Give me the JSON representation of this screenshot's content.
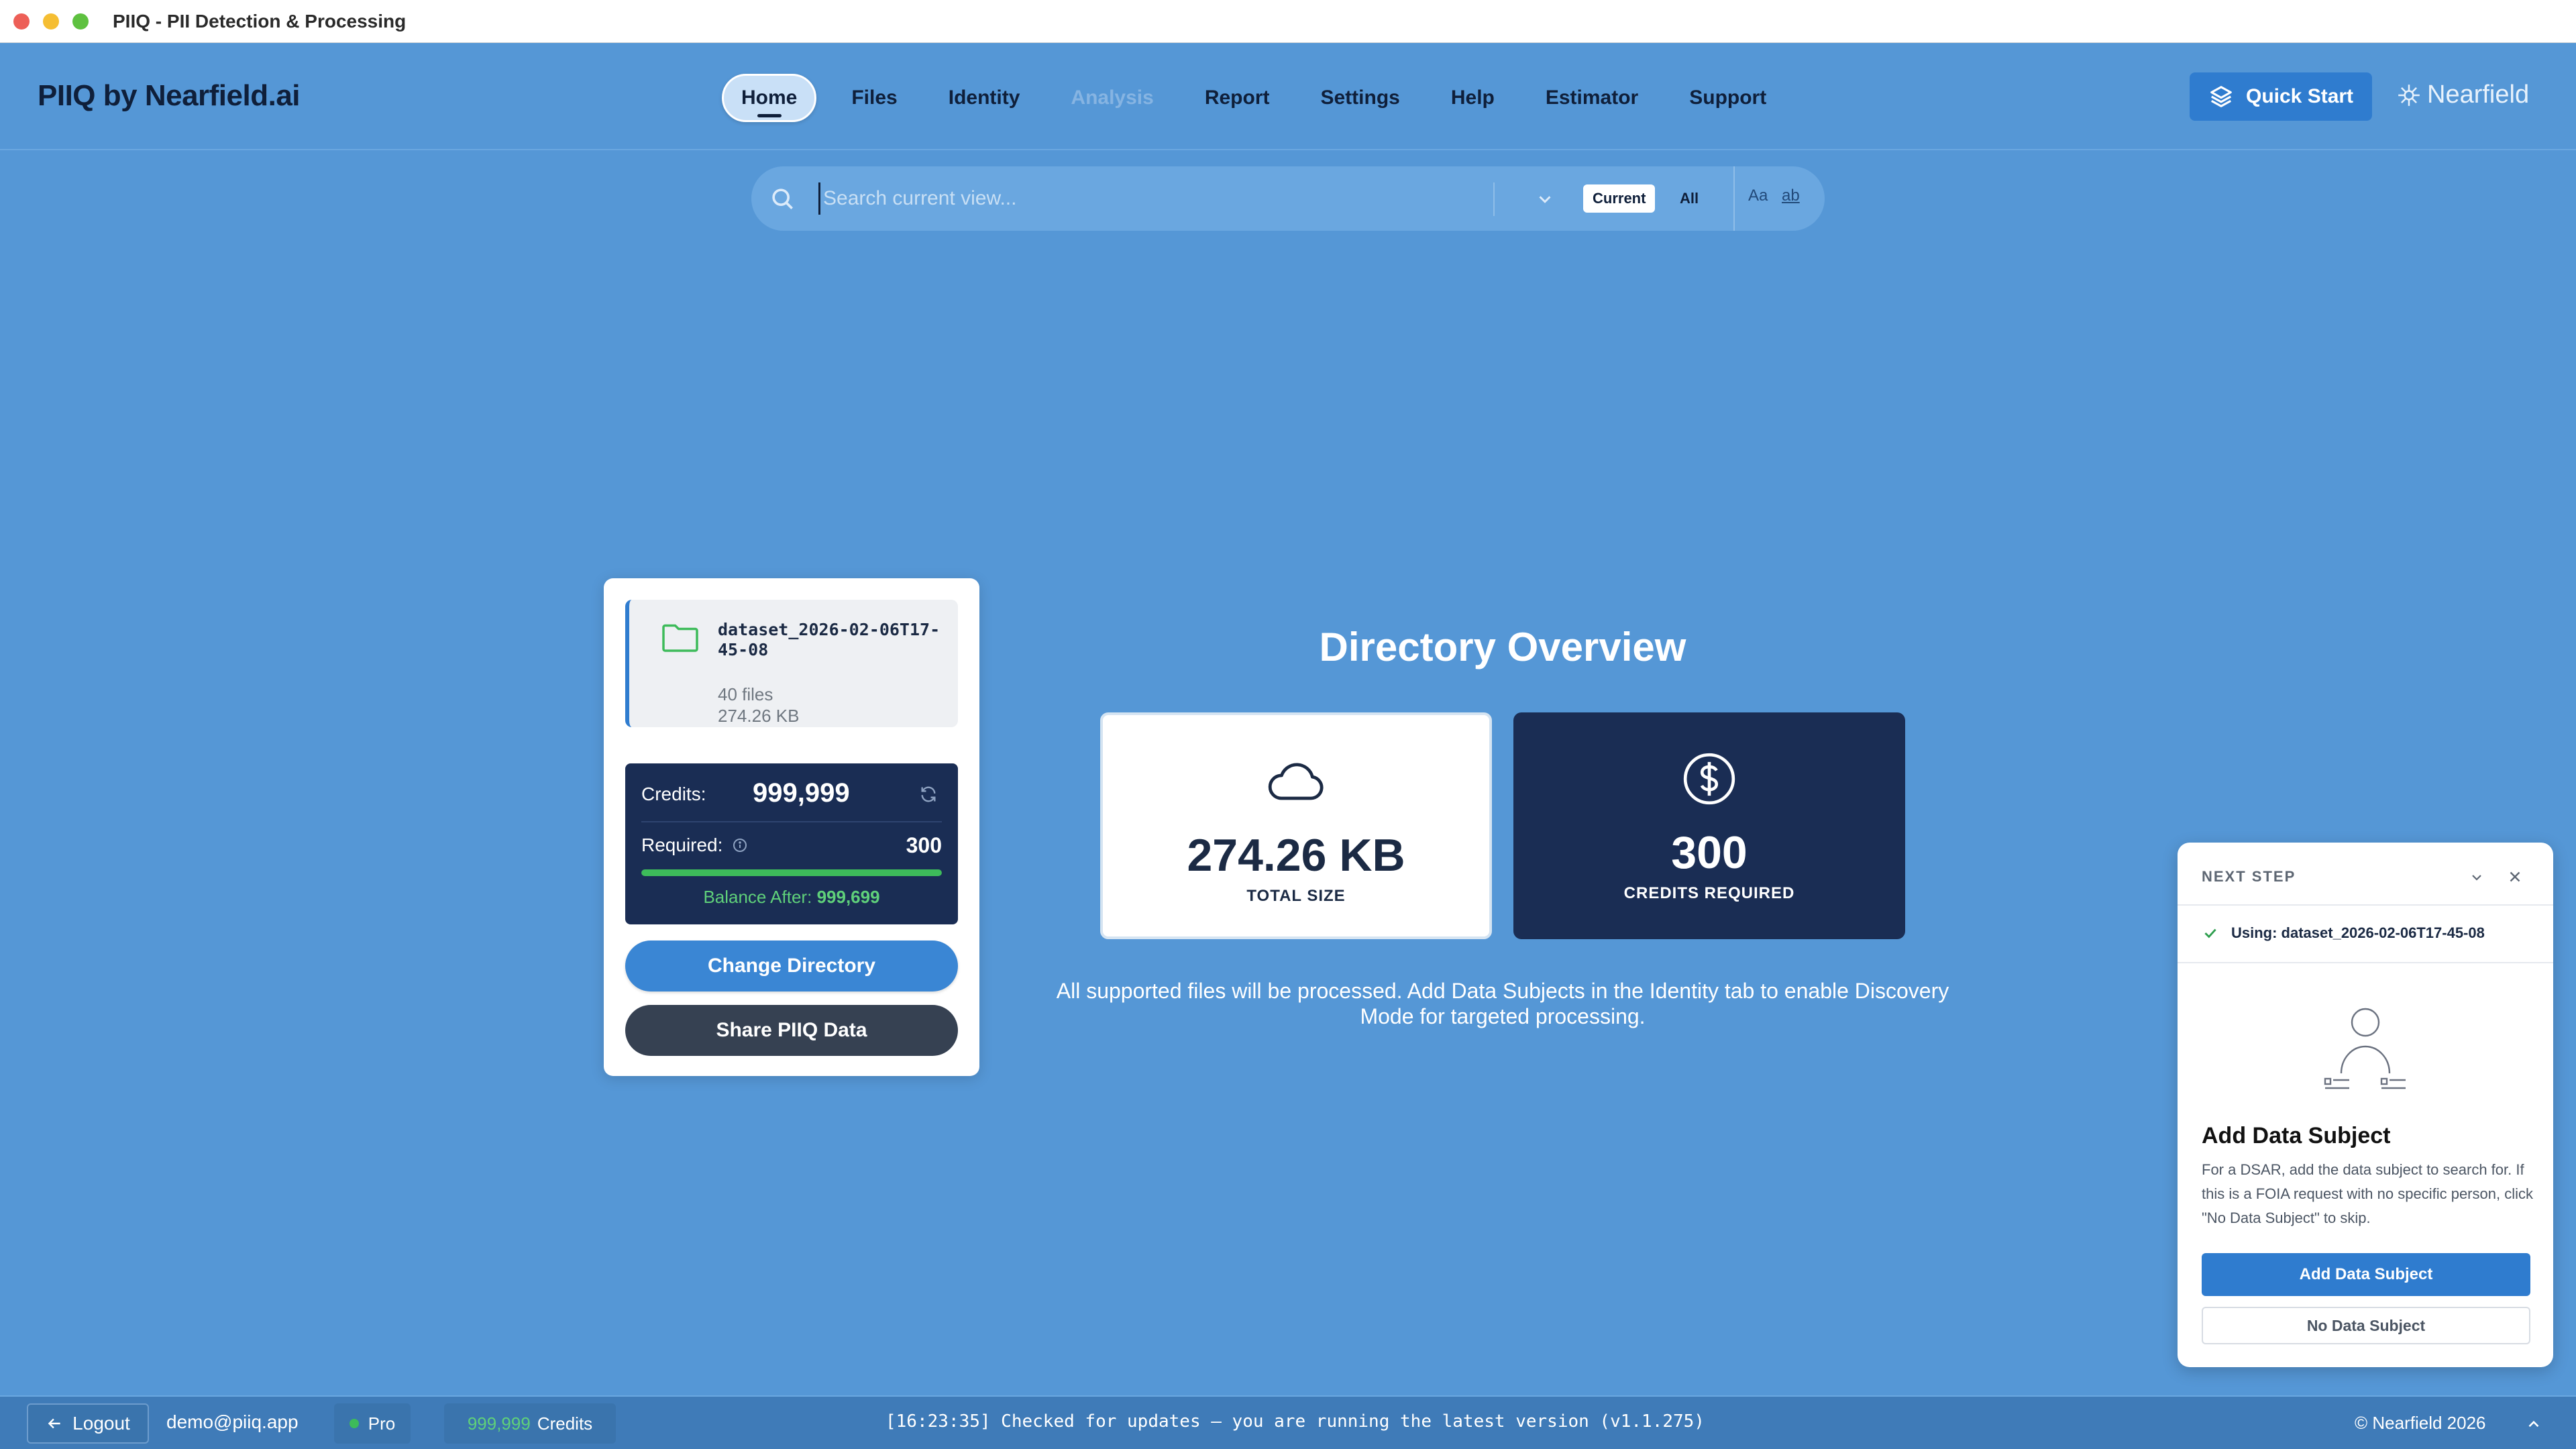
{
  "window": {
    "title": "PIIQ - PII Detection & Processing"
  },
  "header": {
    "brand": "PIIQ by Nearfield.ai",
    "nav": [
      {
        "label": "Home",
        "state": "active"
      },
      {
        "label": "Files",
        "state": "normal"
      },
      {
        "label": "Identity",
        "state": "normal"
      },
      {
        "label": "Analysis",
        "state": "disabled"
      },
      {
        "label": "Report",
        "state": "normal"
      },
      {
        "label": "Settings",
        "state": "normal"
      },
      {
        "label": "Help",
        "state": "normal"
      },
      {
        "label": "Estimator",
        "state": "normal"
      },
      {
        "label": "Support",
        "state": "normal"
      }
    ],
    "quick_start_label": "Quick Start",
    "logo_text": "Nearfield"
  },
  "search": {
    "placeholder": "Search current view...",
    "scope_current": "Current",
    "scope_all": "All",
    "match_case_label": "Aa",
    "whole_word_label": "ab"
  },
  "directory": {
    "name": "dataset_2026-02-06T17-45-08",
    "files": "40 files",
    "size": "274.26 KB"
  },
  "credits": {
    "label": "Credits:",
    "value": "999,999",
    "required_label": "Required:",
    "required_value": "300",
    "required_fraction": 0.9997,
    "balance_label": "Balance After:",
    "balance_value": "999,699"
  },
  "actions": {
    "change_directory": "Change Directory",
    "share": "Share PIIQ Data"
  },
  "overview": {
    "title": "Directory Overview",
    "total_size_value": "274.26 KB",
    "total_size_caption": "TOTAL SIZE",
    "credits_value": "300",
    "credits_caption": "CREDITS REQUIRED",
    "note": "All supported files will be processed. Add Data Subjects in the Identity tab to enable Discovery Mode for targeted processing."
  },
  "next_step": {
    "heading": "NEXT STEP",
    "using": "Using: dataset_2026-02-06T17-45-08",
    "title": "Add Data Subject",
    "description": "For a DSAR, add the data subject to search for. If this is a FOIA request with no specific person, click \"No Data Subject\" to skip.",
    "add_button": "Add Data Subject",
    "none_button": "No Data Subject"
  },
  "statusbar": {
    "logout": "Logout",
    "email": "demo@piiq.app",
    "plan": "Pro",
    "credits_value": "999,999",
    "credits_label": "Credits",
    "message": "[16:23:35] Checked for updates — you are running the latest version (v1.1.275)",
    "copyright": "© Nearfield 2026"
  },
  "colors": {
    "background": "#5597d6",
    "navy": "#1a2d54",
    "accent": "#2f7ccf",
    "success": "#3dbb5a"
  },
  "icons": [
    "search-icon",
    "chevron-down-icon",
    "layers-icon",
    "nearfield-logo-icon",
    "folder-icon",
    "refresh-icon",
    "info-icon",
    "cloud-icon",
    "dollar-icon",
    "check-icon",
    "minimize-chevron-icon",
    "close-icon",
    "person-icon",
    "arrow-left-icon",
    "caret-up-icon"
  ]
}
